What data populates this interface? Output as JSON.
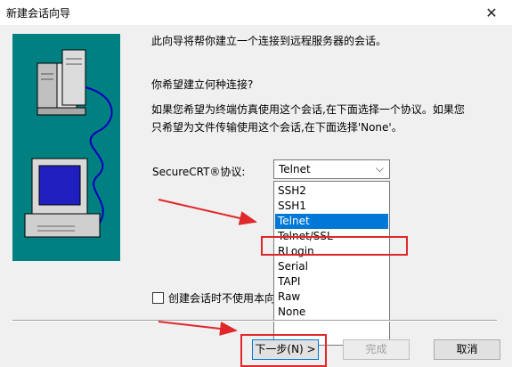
{
  "window": {
    "title": "新建会话向导"
  },
  "intro": "此向导将帮你建立一个连接到远程服务器的会话。",
  "question": "你希望建立何种连接?",
  "explanation_line1": "如果您希望为终端仿真使用这个会话,在下面选择一个协议。如果您",
  "explanation_line2": "只希望为文件传输使用这个会话,在下面选择'None'。",
  "protocol": {
    "label": "SecureCRT®协议:",
    "selected": "Telnet",
    "options": [
      "SSH2",
      "SSH1",
      "Telnet",
      "Telnet/SSL",
      "RLogin",
      "Serial",
      "TAPI",
      "Raw",
      "None"
    ]
  },
  "checkbox": {
    "label": "创建会话时不使用本向导",
    "checked": false
  },
  "buttons": {
    "next": "下一步(N) >",
    "finish": "完成",
    "cancel": "取消"
  },
  "colors": {
    "art_bg": "#008080",
    "selection": "#0078d7",
    "highlight": "#e0272a"
  }
}
